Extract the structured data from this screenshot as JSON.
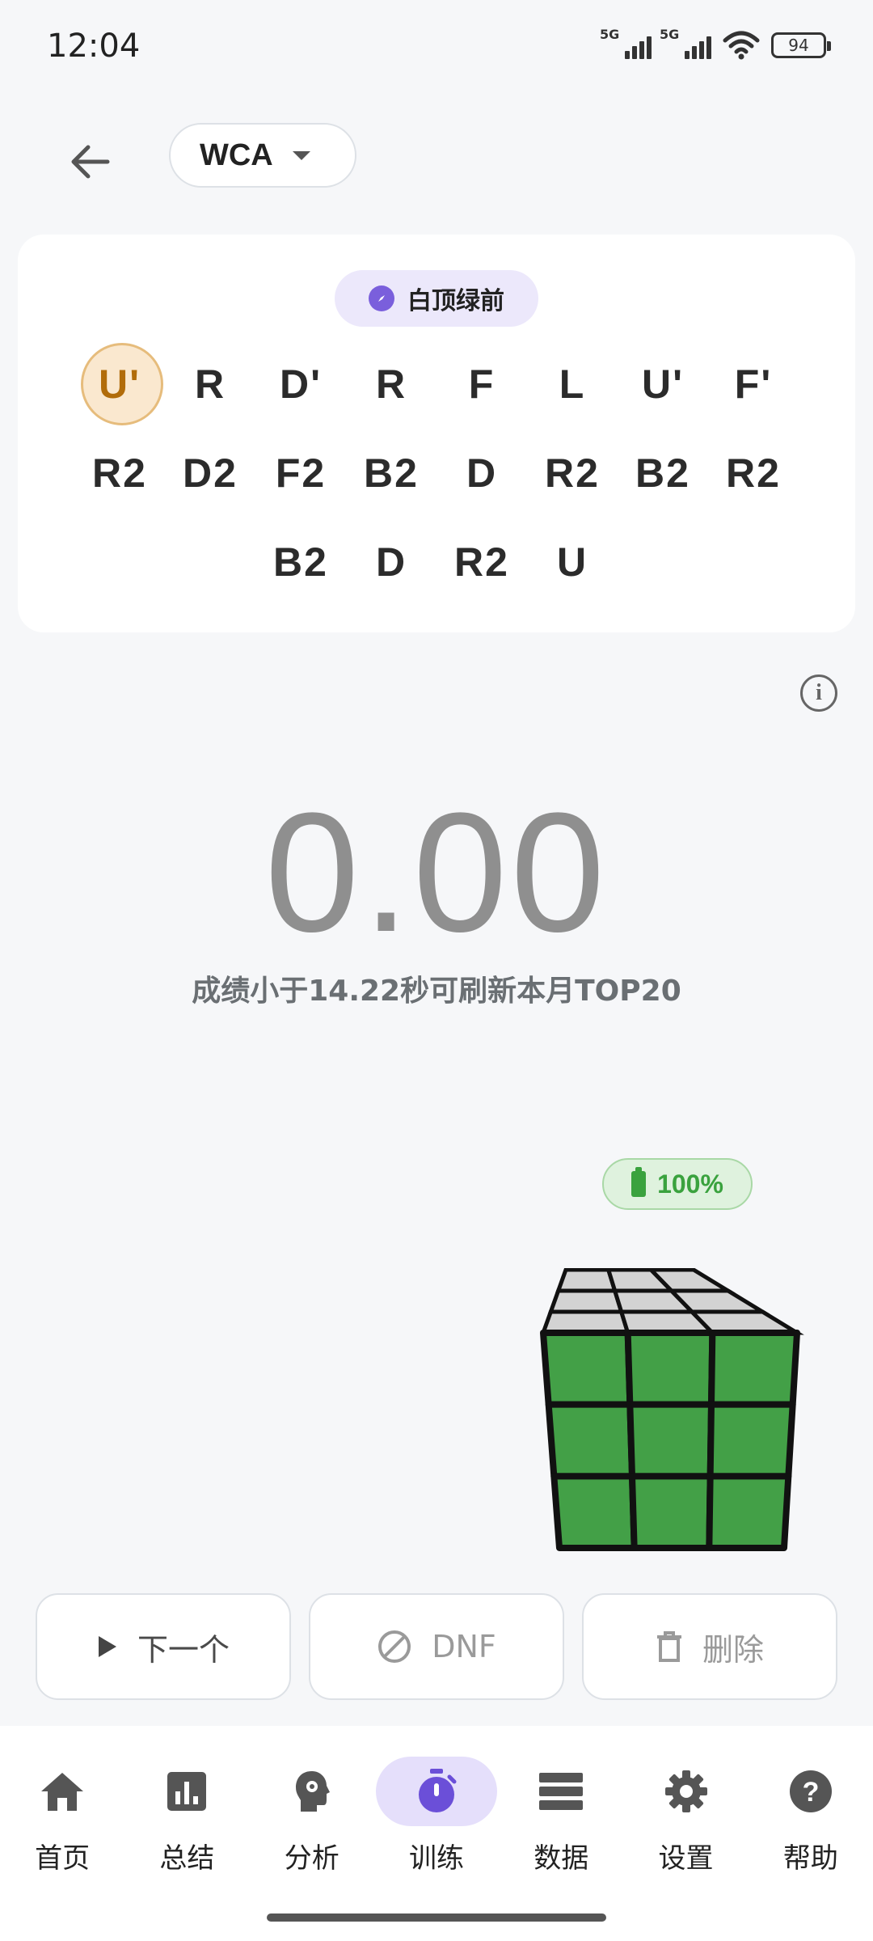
{
  "status_bar": {
    "time": "12:04",
    "signal1_label": "5G",
    "signal2_label": "5G",
    "battery_level": "94",
    "icons": [
      "signal-5g-icon",
      "signal-5g-icon",
      "wifi-icon",
      "battery-icon"
    ]
  },
  "header": {
    "back_icon": "arrow-left-icon",
    "event_label": "WCA",
    "event_caret_icon": "caret-down-icon"
  },
  "scramble": {
    "orientation_label": "白顶绿前",
    "orientation_icon": "compass-icon",
    "current_index": 0,
    "rows": [
      [
        "U'",
        "R",
        "D'",
        "R",
        "F",
        "L",
        "U'",
        "F'"
      ],
      [
        "R2",
        "D2",
        "F2",
        "B2",
        "D",
        "R2",
        "B2",
        "R2"
      ],
      [
        "B2",
        "D",
        "R2",
        "U"
      ]
    ]
  },
  "info_icon": "info-icon",
  "timer": {
    "value": "0.00",
    "hint": "成绩小于14.22秒可刷新本月TOP20"
  },
  "cube_battery": {
    "label": "100%",
    "icon": "battery-full-icon"
  },
  "cube_colors": {
    "top": "#d3d3d3",
    "front": "#43a047",
    "border": "#111111"
  },
  "actions": {
    "next_label": "下一个",
    "next_icon": "play-icon",
    "dnf_label": "DNF",
    "dnf_icon": "prohibit-icon",
    "delete_label": "删除",
    "delete_icon": "trash-icon"
  },
  "nav": {
    "active": "训练",
    "items": [
      {
        "label": "首页",
        "icon": "home-icon"
      },
      {
        "label": "总结",
        "icon": "bar-chart-icon"
      },
      {
        "label": "分析",
        "icon": "head-gear-icon"
      },
      {
        "label": "训练",
        "icon": "stopwatch-icon"
      },
      {
        "label": "数据",
        "icon": "database-icon"
      },
      {
        "label": "设置",
        "icon": "gear-icon"
      },
      {
        "label": "帮助",
        "icon": "help-icon"
      }
    ]
  },
  "colors": {
    "accent": "#7a5fdc",
    "accent_bg": "#e5dffb",
    "highlight_bg": "#fae8cf",
    "highlight_text": "#b16c0a",
    "success": "#3aa23e"
  }
}
